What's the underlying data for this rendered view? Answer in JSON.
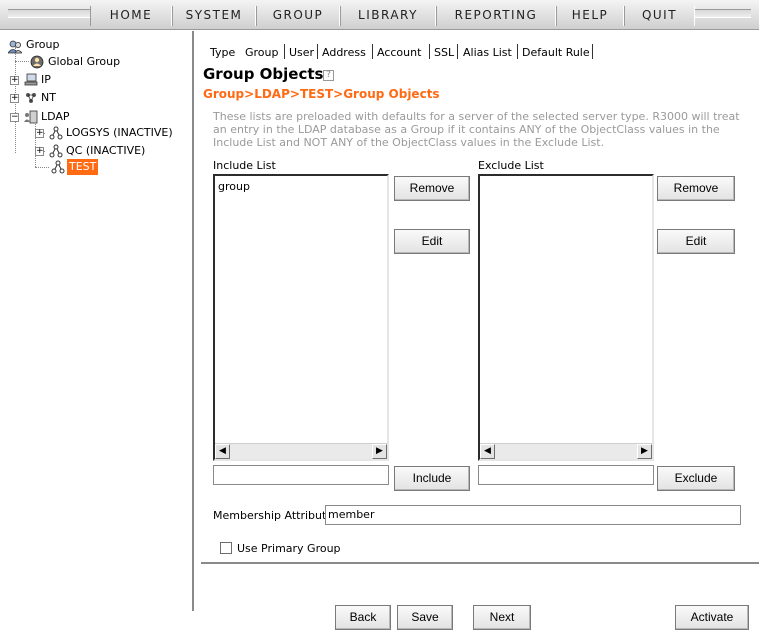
{
  "menu": {
    "items": [
      "HOME",
      "SYSTEM",
      "GROUP",
      "LIBRARY",
      "REPORTING",
      "HELP",
      "QUIT"
    ]
  },
  "tree": {
    "root": "Group",
    "global_group": "Global Group",
    "ip": "IP",
    "nt": "NT",
    "ldap": "LDAP",
    "logsys": "LOGSYS (INACTIVE)",
    "qc": "QC (INACTIVE)",
    "test": "TEST"
  },
  "tabs": [
    "Type",
    "Group",
    "User",
    "Address",
    "Account",
    "SSL",
    "Alias List",
    "Default Rule"
  ],
  "page": {
    "title": "Group Objects",
    "help_glyph": "?",
    "breadcrumb": "Group>LDAP>TEST>Group Objects",
    "description": "These lists are preloaded with defaults for a server of the selected server type.  R3000 will treat an entry in the LDAP database as a Group if it contains ANY of the ObjectClass values in the Include List and NOT ANY of the ObjectClass values in the Exclude List."
  },
  "include_list": {
    "label": "Include List",
    "items": [
      "group"
    ],
    "input_value": "",
    "remove_label": "Remove",
    "edit_label": "Edit",
    "add_label": "Include"
  },
  "exclude_list": {
    "label": "Exclude List",
    "items": [],
    "input_value": "",
    "remove_label": "Remove",
    "edit_label": "Edit",
    "add_label": "Exclude"
  },
  "membership": {
    "label": "Membership Attribute",
    "value": "member"
  },
  "primary_group": {
    "label": "Use Primary Group",
    "checked": false
  },
  "footer": {
    "back": "Back",
    "save": "Save",
    "next": "Next",
    "activate": "Activate"
  },
  "colors": {
    "accent": "#ff6a13",
    "description_text": "#9a9a9a"
  },
  "scroll_arrows": {
    "left": "◀",
    "right": "▶"
  }
}
